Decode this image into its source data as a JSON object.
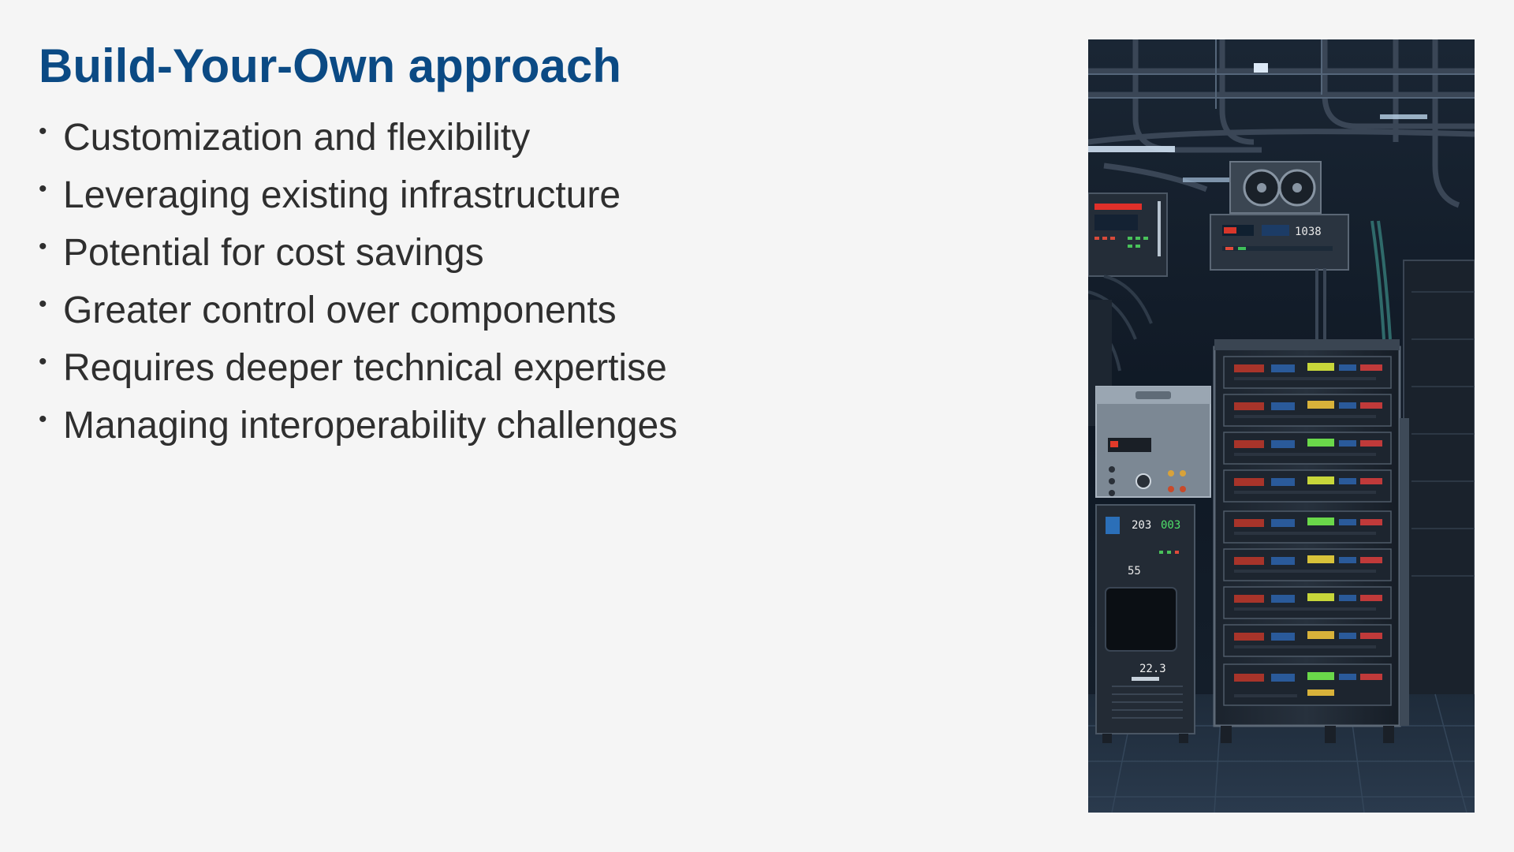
{
  "slide": {
    "title": "Build-Your-Own approach",
    "bullets": [
      "Customization and flexibility",
      "Leveraging existing infrastructure",
      "Potential for cost savings",
      "Greater control over components",
      "Requires deeper technical expertise",
      "Managing interoperability challenges"
    ],
    "bullet_glyph": "•",
    "image": {
      "subject": "server-rack-photo",
      "display_readouts": [
        "203",
        "003",
        "55",
        "22.3",
        "1038"
      ]
    }
  },
  "colors": {
    "background": "#f5f5f5",
    "title": "#0b4a84",
    "body_text": "#2f2f2f"
  }
}
